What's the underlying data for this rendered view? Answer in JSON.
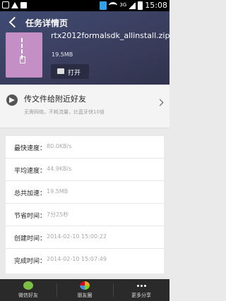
{
  "status_bar": {
    "time": "15:08",
    "network": "3G"
  },
  "header": {
    "title": "任务详情页",
    "file_name": "rtx2012formalsdk_allinstall.zip",
    "file_size": "19.5MB",
    "open_label": "打开"
  },
  "share_nearby": {
    "title": "传文件给附近好友",
    "subtitle": "无需网络，不耗流量，比蓝牙快10倍"
  },
  "details": {
    "rows": [
      {
        "label": "最快速度：",
        "value": "80.0KB/s"
      },
      {
        "label": "平均速度：",
        "value": "44.9KB/s"
      },
      {
        "label": "总共加速：",
        "value": "19.5MB"
      },
      {
        "label": "节省时间：",
        "value": "7分25秒"
      },
      {
        "label": "创建时间：",
        "value": "2014-02-10 15:00:22"
      },
      {
        "label": "完成时间：",
        "value": "2014-02-10 15:07:49"
      }
    ]
  },
  "bottom_bar": {
    "tabs": [
      {
        "label": "微信好友",
        "icon": "wechat-icon"
      },
      {
        "label": "朋友圈",
        "icon": "moments-icon"
      },
      {
        "label": "更多分享",
        "icon": "more-icon"
      }
    ]
  }
}
